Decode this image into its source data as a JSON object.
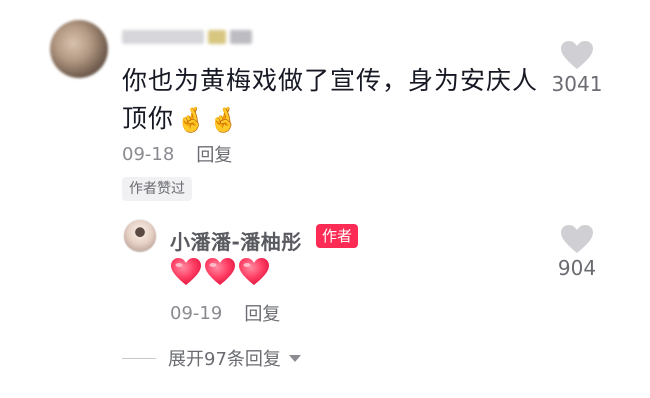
{
  "comment": {
    "text_line1": "你也为黄梅戏做了宣传，身为安庆人",
    "text_line2": "顶你",
    "emojis": [
      "🤞",
      "🤞"
    ],
    "date": "09-18",
    "reply_label": "回复",
    "author_liked_label": "作者赞过",
    "like_count": "3041"
  },
  "reply": {
    "author_name": "小潘潘-潘柚彤",
    "author_badge": "作者",
    "hearts": [
      "heart",
      "heart",
      "heart"
    ],
    "date": "09-19",
    "reply_label": "回复",
    "like_count": "904"
  },
  "expand": {
    "label": "展开97条回复"
  },
  "colors": {
    "accent": "#fe2c55",
    "heart_outline": "#d0d0d4",
    "text_primary": "#161823",
    "text_secondary": "#8a8b91"
  }
}
